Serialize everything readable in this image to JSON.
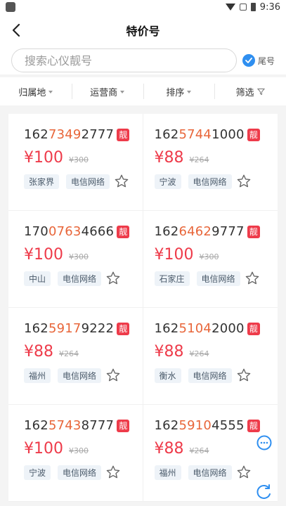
{
  "status_bar": {
    "time": "9:36"
  },
  "header": {
    "title": "特价号"
  },
  "search": {
    "placeholder": "搜索心仪靓号",
    "tail_label": "尾号"
  },
  "filters": [
    {
      "label": "归属地"
    },
    {
      "label": "运营商"
    },
    {
      "label": "排序"
    },
    {
      "label": "筛选"
    }
  ],
  "colors": {
    "accent_red": "#ee3b4a",
    "highlight_orange": "#e8663a",
    "check_blue": "#2f8ff0"
  },
  "listings": [
    {
      "prefix": "162",
      "highlight": "7349",
      "suffix": "2777",
      "badge": "靓",
      "price": "¥100",
      "old_price": "¥300",
      "city": "张家界",
      "network": "电信网络"
    },
    {
      "prefix": "162",
      "highlight": "5744",
      "suffix": "1000",
      "badge": "靓",
      "price": "¥88",
      "old_price": "¥264",
      "city": "宁波",
      "network": "电信网络"
    },
    {
      "prefix": "170",
      "highlight": "0763",
      "suffix": "4666",
      "badge": "靓",
      "price": "¥100",
      "old_price": "¥300",
      "city": "中山",
      "network": "电信网络"
    },
    {
      "prefix": "162",
      "highlight": "6462",
      "suffix": "9777",
      "badge": "靓",
      "price": "¥100",
      "old_price": "¥300",
      "city": "石家庄",
      "network": "电信网络"
    },
    {
      "prefix": "162",
      "highlight": "5917",
      "suffix": "9222",
      "badge": "靓",
      "price": "¥88",
      "old_price": "¥264",
      "city": "福州",
      "network": "电信网络"
    },
    {
      "prefix": "162",
      "highlight": "5104",
      "suffix": "2000",
      "badge": "靓",
      "price": "¥88",
      "old_price": "¥264",
      "city": "衡水",
      "network": "电信网络"
    },
    {
      "prefix": "162",
      "highlight": "5743",
      "suffix": "8777",
      "badge": "靓",
      "price": "¥100",
      "old_price": "¥300",
      "city": "宁波",
      "network": "电信网络"
    },
    {
      "prefix": "162",
      "highlight": "5910",
      "suffix": "4555",
      "badge": "靓",
      "price": "¥88",
      "old_price": "¥264",
      "city": "福州",
      "network": "电信网络"
    }
  ]
}
